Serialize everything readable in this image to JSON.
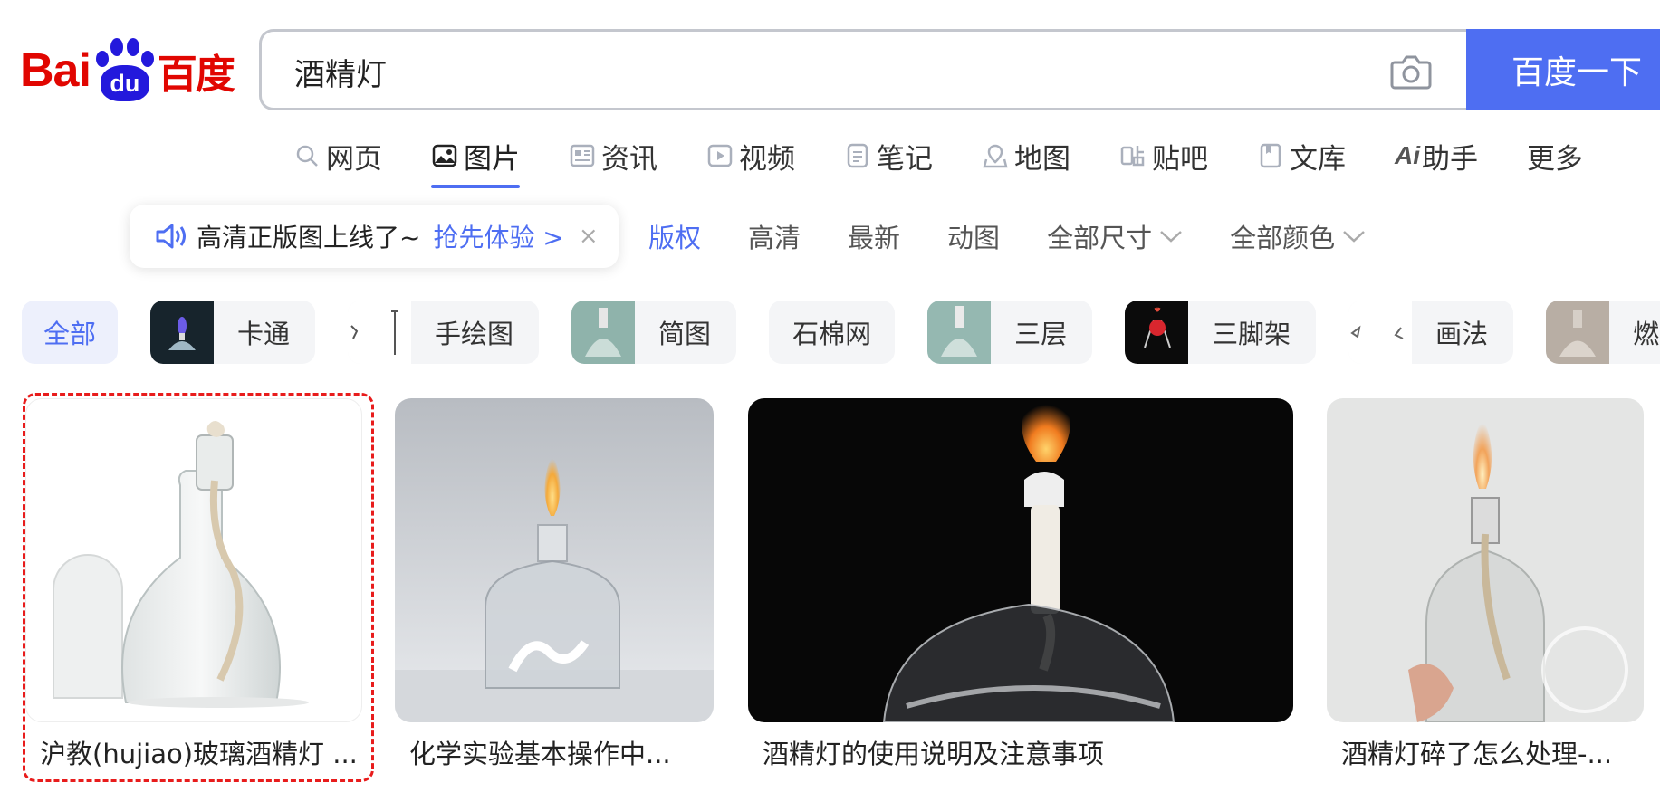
{
  "logo": {
    "bai": "Bai",
    "du": "du",
    "baidu_cn": "百度"
  },
  "search": {
    "query": "酒精灯",
    "button_label": "百度一下"
  },
  "tabs": [
    {
      "label": "网页",
      "icon": "search-icon"
    },
    {
      "label": "图片",
      "icon": "image-icon",
      "active": true
    },
    {
      "label": "资讯",
      "icon": "news-icon"
    },
    {
      "label": "视频",
      "icon": "video-icon"
    },
    {
      "label": "笔记",
      "icon": "note-icon"
    },
    {
      "label": "地图",
      "icon": "map-icon"
    },
    {
      "label": "贴吧",
      "icon": "tieba-icon"
    },
    {
      "label": "文库",
      "icon": "library-icon"
    },
    {
      "label": "助手",
      "icon": "ai-icon",
      "prefix": "Ai"
    },
    {
      "label": "更多"
    }
  ],
  "promo": {
    "text": "高清正版图上线了~",
    "link": "抢先体验 >",
    "close": "×"
  },
  "filters": [
    {
      "label": "版权",
      "active": true
    },
    {
      "label": "高清"
    },
    {
      "label": "最新"
    },
    {
      "label": "动图"
    },
    {
      "label": "全部尺寸",
      "dropdown": true
    },
    {
      "label": "全部颜色",
      "dropdown": true
    }
  ],
  "chips": [
    {
      "label": "全部",
      "active": true
    },
    {
      "label": "卡通"
    },
    {
      "label": "手绘图"
    },
    {
      "label": "简图"
    },
    {
      "label": "石棉网"
    },
    {
      "label": "三层"
    },
    {
      "label": "三脚架"
    },
    {
      "label": "画法"
    },
    {
      "label": "燃烧"
    }
  ],
  "results": [
    {
      "caption": "沪教(hujiao)玻璃酒精灯 ..."
    },
    {
      "caption": "化学实验基本操作中..."
    },
    {
      "caption": "酒精灯的使用说明及注意事项"
    },
    {
      "caption": "酒精灯碎了怎么处理-..."
    }
  ],
  "colors": {
    "brand_blue": "#4e6ef2",
    "logo_red": "#e10601",
    "logo_blue": "#2319dc",
    "selection_red": "#e81c1c"
  }
}
